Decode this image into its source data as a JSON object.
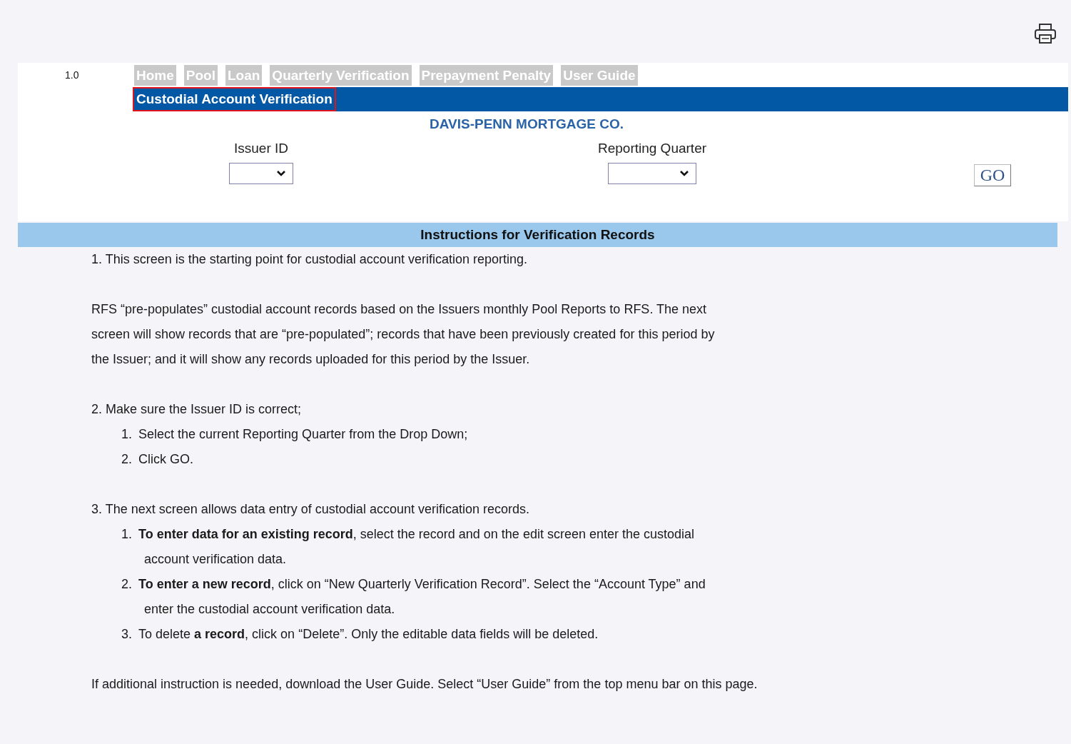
{
  "version": "1.0",
  "tabs": [
    {
      "label": "Home"
    },
    {
      "label": "Pool"
    },
    {
      "label": "Loan"
    },
    {
      "label": "Quarterly Verification"
    },
    {
      "label": "Prepayment Penalty"
    },
    {
      "label": "User Guide"
    }
  ],
  "subnav": [
    {
      "label": "Custodial Account Verification",
      "selected": true
    }
  ],
  "company": "DAVIS-PENN MORTGAGE CO.",
  "fields": [
    {
      "label": "Issuer ID",
      "kind": "short"
    },
    {
      "label": "Reporting Quarter",
      "kind": "wide"
    }
  ],
  "go_button": "GO",
  "instructions": {
    "title": "Instructions for Verification Records",
    "sections": [
      {
        "text": "1. This screen is the starting point for custodial account verification reporting."
      },
      {
        "text": "RFS “pre-populates” custodial account records based on the Issuers monthly Pool Reports to RFS. The next screen will show records that are “pre-populated”; records that have been previously created for this period by the Issuer; and it will show any records uploaded for this period by the Issuer."
      },
      {
        "text": "2. Make sure the Issuer ID is correct;",
        "steps": [
          {
            "number": "1.",
            "text": "Select the current Reporting Quarter from the Drop Down;"
          },
          {
            "number": "2.",
            "text": "Click GO."
          }
        ]
      },
      {
        "text": "3. The next screen allows data entry of custodial account verification records.",
        "steps": [
          {
            "number": "1.",
            "text": "**To enter data for an existing record**, select the record and on the edit screen enter the custodial account verification data."
          },
          {
            "number": "2.",
            "text": "**To enter a new record**, click on “New Quarterly Verification Record”. Select the “Account Type” and enter the custodial account verification data."
          },
          {
            "number": "3.",
            "text": "To delete **a record**, click on “Delete”. Only the editable data fields will be deleted."
          }
        ]
      },
      {
        "text": "If additional instruction is needed, download the User Guide. Select “User Guide” from the top menu bar on this page."
      }
    ]
  }
}
